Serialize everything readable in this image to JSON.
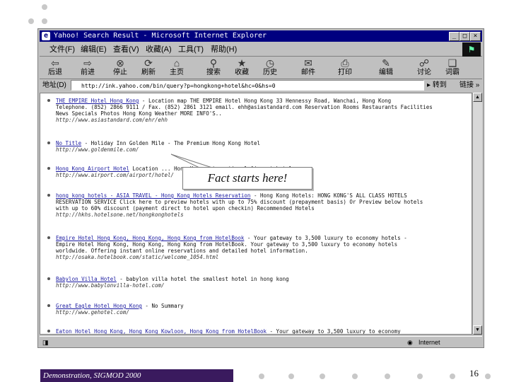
{
  "window": {
    "title": "Yahoo! Search Result - Microsoft Internet Explorer"
  },
  "menu": [
    "文件(F)",
    "编辑(E)",
    "查看(V)",
    "收藏(A)",
    "工具(T)",
    "帮助(H)"
  ],
  "toolbar": [
    {
      "label": "后退",
      "icon": "back-arrow"
    },
    {
      "label": "前进",
      "icon": "forward-arrow"
    },
    {
      "label": "停止",
      "icon": "stop-icon"
    },
    {
      "label": "刷新",
      "icon": "refresh-icon"
    },
    {
      "label": "主页",
      "icon": "home-icon"
    },
    {
      "label": "搜索",
      "icon": "search-icon"
    },
    {
      "label": "收藏",
      "icon": "favorites-icon"
    },
    {
      "label": "历史",
      "icon": "history-icon"
    },
    {
      "label": "邮件",
      "icon": "mail-icon"
    },
    {
      "label": "打印",
      "icon": "print-icon"
    },
    {
      "label": "编辑",
      "icon": "edit-icon"
    },
    {
      "label": "讨论",
      "icon": "discuss-icon"
    },
    {
      "label": "词霸",
      "icon": "dictionary-icon"
    }
  ],
  "address": {
    "label": "地址(D)",
    "url": "http://ink.yahoo.com/bin/query?p=hongkong+hotel&hc=0&hs=0",
    "go": "转到",
    "links": "链接 »"
  },
  "results": [
    {
      "title": "THE EMPIRE Hotel Hong Kong",
      "lines": [
        " - Location map THE EMPIRE Hotel Hong Kong 33 Hennessy Road, Wanchai, Hong Kong",
        "Telephone. (852) 2866 9111 / Fax. (852) 2861 3121 email. ehh@asiastandard.com Reservation Rooms Restaurants Facilities",
        "News Specials Photos Hong Kong Weather MORE INFO'S.."
      ],
      "url": "http://www.asiastandard.com/ehr/ehh"
    },
    {
      "title": "No Title",
      "lines": [
        " - Holiday Inn Golden Mile - The Premium Hong Kong Hotel"
      ],
      "url": "http://www.goldenmile.com/"
    },
    {
      "title": "Hong Kong Airport Hotel",
      "lines": [
        " Location ... Hong Kong International Airport hotel"
      ],
      "url": "http://www.airport.com/airport/hotel/"
    },
    {
      "title": "hong kong hotels - ASIA TRAVEL - Hong Kong Hotels Reservation",
      "lines": [
        " - Hong Kong Hotels: HONG KONG'S ALL CLASS HOTELS",
        "RESERVATION SERVICE Click here to preview hotels with up to 75% discount (prepayment basis) Or Preview below hotels",
        "with up to 60% discount (payment direct to hotel upon checkin) Recommended Hotels"
      ],
      "url": "http://hkhs.hotelsone.net/hongkonghotels"
    },
    {
      "title": "Empire Hotel Hong Kong, Hong Kong, Hong Kong from HotelBook",
      "lines": [
        " - Your gateway to 3,500 luxury to economy hotels -",
        "Empire Hotel Hong Kong, Hong Kong, Hong Kong from HotelBook. Your gateway to 3,500 luxury to economy hotels",
        "worldwide. Offering instant online reservations and detailed hotel information."
      ],
      "url": "http://osaka.hotelbook.com/static/welcome_1054.html"
    },
    {
      "title": "Babylon Villa Hotel",
      "lines": [
        " - babylon villa hotel the smallest hotel in hong kong"
      ],
      "url": "http://www.babylonvilla-hotel.com/"
    },
    {
      "title": "Great Eagle Hotel Hong Kong",
      "lines": [
        " - No Summary"
      ],
      "url": "http://www.gehotel.com/"
    },
    {
      "title": "Eaton Hotel Hong Kong, Hong Kong Kowloon, Hong Kong from HotelBook",
      "lines": [
        " - Your gateway to 3,500 luxury to economy"
      ],
      "url": ""
    }
  ],
  "status": {
    "zone": "Internet"
  },
  "callout": "Fact starts here!",
  "footer": "Demonstration, SIGMOD 2000",
  "page_number": "16"
}
